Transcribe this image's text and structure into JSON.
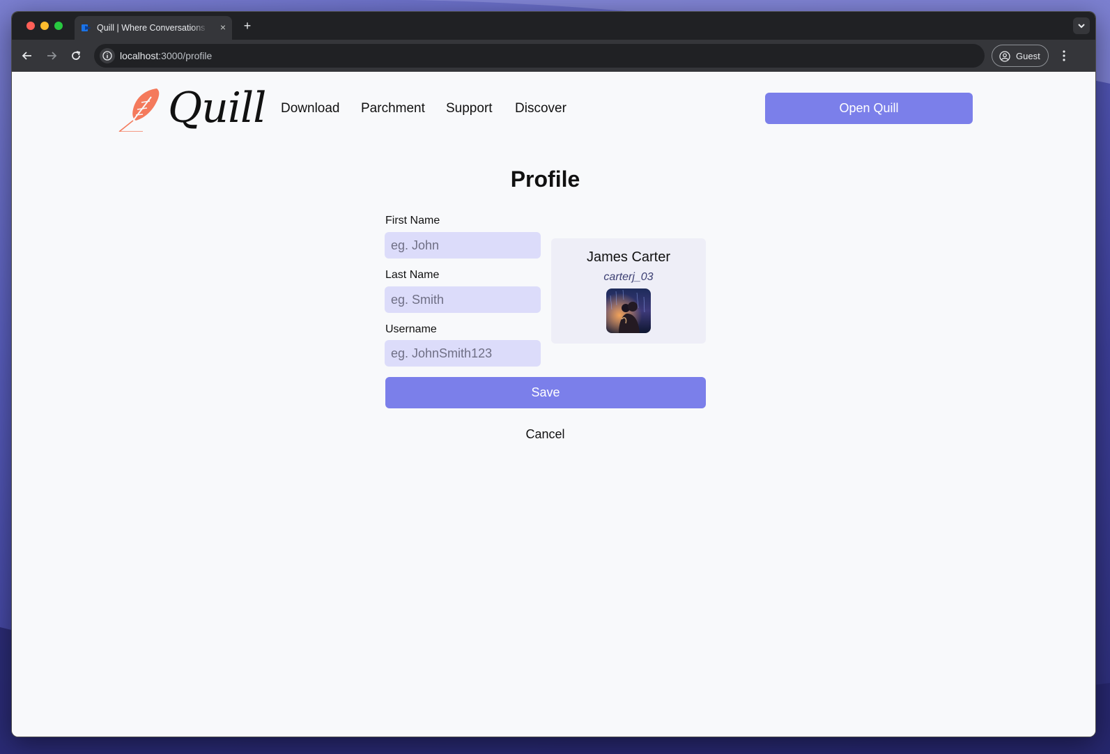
{
  "browser": {
    "tab_title": "Quill | Where Conversations F",
    "tab_close": "×",
    "new_tab": "+",
    "url_host": "localhost",
    "url_path": ":3000/profile",
    "profile_label": "Guest"
  },
  "header": {
    "logo_text": "Quill",
    "nav": [
      "Download",
      "Parchment",
      "Support",
      "Discover"
    ],
    "cta_label": "Open Quill"
  },
  "profile": {
    "title": "Profile",
    "first_name": {
      "label": "First Name",
      "placeholder": "eg. John",
      "value": ""
    },
    "last_name": {
      "label": "Last Name",
      "placeholder": "eg. Smith",
      "value": ""
    },
    "username": {
      "label": "Username",
      "placeholder": "eg. JohnSmith123",
      "value": ""
    },
    "card": {
      "name": "James Carter",
      "username": "carterj_03"
    },
    "save_label": "Save",
    "cancel_label": "Cancel"
  },
  "colors": {
    "accent": "#7b7fea",
    "input_bg": "#dcdcfa",
    "card_bg": "#eeeef7",
    "logo_feather": "#f47a5c"
  },
  "icons": [
    "back-arrow-icon",
    "forward-arrow-icon",
    "reload-icon",
    "site-info-icon",
    "guest-profile-icon",
    "more-menu-icon",
    "tab-list-icon",
    "feather-logo-icon"
  ]
}
